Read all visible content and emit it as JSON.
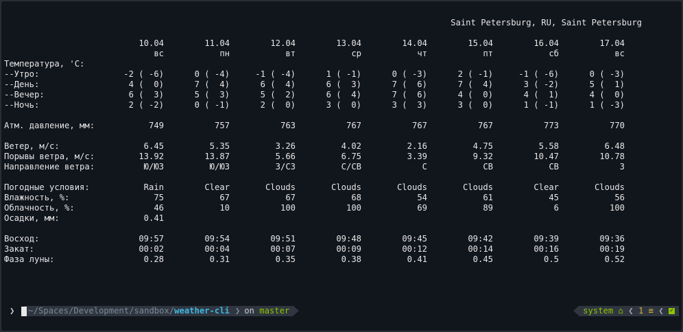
{
  "location": "Saint Petersburg, RU, Saint Petersburg",
  "days": [
    {
      "date": "10.04",
      "dow": "вс"
    },
    {
      "date": "11.04",
      "dow": "пн"
    },
    {
      "date": "12.04",
      "dow": "вт"
    },
    {
      "date": "13.04",
      "dow": "ср"
    },
    {
      "date": "14.04",
      "dow": "чт"
    },
    {
      "date": "15.04",
      "dow": "пт"
    },
    {
      "date": "16.04",
      "dow": "сб"
    },
    {
      "date": "17.04",
      "dow": "вс"
    }
  ],
  "rows": [
    {
      "label": "Температура, 'C:",
      "values": []
    },
    {
      "label": "--Утро:",
      "values": [
        "-2 ( -6)",
        "0 ( -4)",
        "-1 ( -4)",
        "1 ( -1)",
        "0 ( -3)",
        "2 ( -1)",
        "-1 ( -6)",
        "0 ( -3)"
      ]
    },
    {
      "label": "--День:",
      "values": [
        "4 (  0)",
        "7 (  4)",
        "6 (  4)",
        "6 (  3)",
        "7 (  6)",
        "7 (  4)",
        "3 ( -2)",
        "5 (  1)"
      ]
    },
    {
      "label": "--Вечер:",
      "values": [
        "6 (  3)",
        "5 (  3)",
        "5 (  2)",
        "6 (  4)",
        "7 (  6)",
        "4 (  0)",
        "4 (  1)",
        "4 (  0)"
      ]
    },
    {
      "label": "--Ночь:",
      "values": [
        "2 ( -2)",
        "0 ( -1)",
        "2 (  0)",
        "3 (  0)",
        "3 (  3)",
        "3 (  0)",
        "1 ( -1)",
        "1 ( -3)"
      ]
    },
    {
      "label": "",
      "values": []
    },
    {
      "label": "Атм. давление, мм:",
      "values": [
        "749",
        "757",
        "763",
        "767",
        "767",
        "767",
        "773",
        "770"
      ]
    },
    {
      "label": "",
      "values": []
    },
    {
      "label": "Ветер, м/с:",
      "values": [
        "6.45",
        "5.35",
        "3.26",
        "4.02",
        "2.16",
        "4.75",
        "5.58",
        "6.48"
      ]
    },
    {
      "label": "Порывы ветра, м/с:",
      "values": [
        "13.92",
        "13.87",
        "5.66",
        "6.75",
        "3.39",
        "9.32",
        "10.47",
        "10.78"
      ]
    },
    {
      "label": "Направление ветра:",
      "values": [
        "Ю/ЮЗ",
        "Ю/ЮЗ",
        "З/СЗ",
        "С/СВ",
        "С",
        "СВ",
        "СВ",
        "З"
      ]
    },
    {
      "label": "",
      "values": []
    },
    {
      "label": "Погодные условия:",
      "values": [
        "Rain",
        "Clear",
        "Clouds",
        "Clouds",
        "Clouds",
        "Clouds",
        "Clear",
        "Clouds"
      ]
    },
    {
      "label": "Влажность, %:",
      "values": [
        "75",
        "67",
        "67",
        "68",
        "54",
        "61",
        "45",
        "56"
      ]
    },
    {
      "label": "Облачность, %:",
      "values": [
        "46",
        "10",
        "100",
        "100",
        "69",
        "89",
        "6",
        "100"
      ]
    },
    {
      "label": "Осадки, мм:",
      "values": [
        "0.41",
        "",
        "",
        "",
        "",
        "",
        "",
        ""
      ]
    },
    {
      "label": "",
      "values": []
    },
    {
      "label": "Восход:",
      "values": [
        "09:57",
        "09:54",
        "09:51",
        "09:48",
        "09:45",
        "09:42",
        "09:39",
        "09:36"
      ]
    },
    {
      "label": "Закат:",
      "values": [
        "00:02",
        "00:04",
        "00:07",
        "00:09",
        "00:12",
        "00:14",
        "00:16",
        "00:19"
      ]
    },
    {
      "label": "Фаза луны:",
      "values": [
        "0.28",
        "0.31",
        "0.35",
        "0.38",
        "0.41",
        "0.45",
        "0.5",
        "0.52"
      ]
    }
  ],
  "prompt": {
    "path_prefix": "~/Spaces/Development/sandbox/",
    "path_dir": "weather-cli",
    "git_on": "on",
    "git_branch": "master",
    "env": "system",
    "jobs_count": "1",
    "prompt_char": "❯",
    "home_icon": "home-icon",
    "jobs_icon": "list-icon",
    "status_icon": "check-icon"
  },
  "colors": {
    "background": "#11151c",
    "foreground": "#e6e6e6",
    "path_accent": "#40b6e0",
    "branch": "#8ec400",
    "jobs": "#d7b43a"
  }
}
